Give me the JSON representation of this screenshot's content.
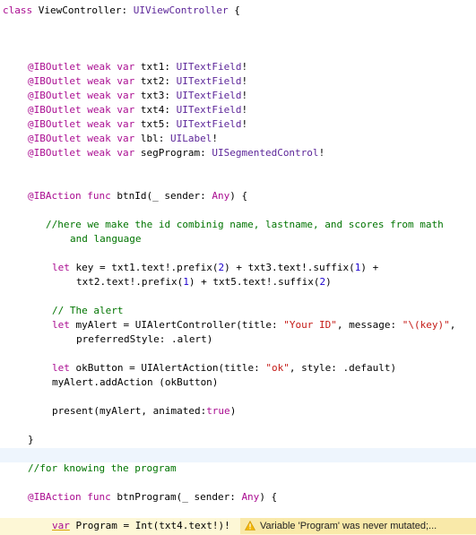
{
  "editor": {
    "lines": [
      {
        "segments": [
          {
            "t": "class ",
            "c": "kw"
          },
          {
            "t": "ViewController",
            "c": "plain"
          },
          {
            "t": ": ",
            "c": "plain"
          },
          {
            "t": "UIViewController",
            "c": "typ"
          },
          {
            "t": " {",
            "c": "plain"
          }
        ]
      },
      {
        "segments": [
          {
            "t": "@IBOutlet ",
            "c": "kw"
          },
          {
            "t": "weak ",
            "c": "kw"
          },
          {
            "t": "var ",
            "c": "kw"
          },
          {
            "t": "txt1: ",
            "c": "plain"
          },
          {
            "t": "UITextField",
            "c": "typ"
          },
          {
            "t": "!",
            "c": "plain"
          }
        ]
      },
      {
        "segments": [
          {
            "t": "@IBOutlet ",
            "c": "kw"
          },
          {
            "t": "weak ",
            "c": "kw"
          },
          {
            "t": "var ",
            "c": "kw"
          },
          {
            "t": "txt2: ",
            "c": "plain"
          },
          {
            "t": "UITextField",
            "c": "typ"
          },
          {
            "t": "!",
            "c": "plain"
          }
        ]
      },
      {
        "segments": [
          {
            "t": "@IBOutlet ",
            "c": "kw"
          },
          {
            "t": "weak ",
            "c": "kw"
          },
          {
            "t": "var ",
            "c": "kw"
          },
          {
            "t": "txt3: ",
            "c": "plain"
          },
          {
            "t": "UITextField",
            "c": "typ"
          },
          {
            "t": "!",
            "c": "plain"
          }
        ]
      },
      {
        "segments": [
          {
            "t": "@IBOutlet ",
            "c": "kw"
          },
          {
            "t": "weak ",
            "c": "kw"
          },
          {
            "t": "var ",
            "c": "kw"
          },
          {
            "t": "txt4: ",
            "c": "plain"
          },
          {
            "t": "UITextField",
            "c": "typ"
          },
          {
            "t": "!",
            "c": "plain"
          }
        ]
      },
      {
        "segments": [
          {
            "t": "@IBOutlet ",
            "c": "kw"
          },
          {
            "t": "weak ",
            "c": "kw"
          },
          {
            "t": "var ",
            "c": "kw"
          },
          {
            "t": "txt5: ",
            "c": "plain"
          },
          {
            "t": "UITextField",
            "c": "typ"
          },
          {
            "t": "!",
            "c": "plain"
          }
        ]
      },
      {
        "segments": [
          {
            "t": "@IBOutlet ",
            "c": "kw"
          },
          {
            "t": "weak ",
            "c": "kw"
          },
          {
            "t": "var ",
            "c": "kw"
          },
          {
            "t": "lbl: ",
            "c": "plain"
          },
          {
            "t": "UILabel",
            "c": "typ"
          },
          {
            "t": "!",
            "c": "plain"
          }
        ]
      },
      {
        "segments": [
          {
            "t": "@IBOutlet ",
            "c": "kw"
          },
          {
            "t": "weak ",
            "c": "kw"
          },
          {
            "t": "var ",
            "c": "kw"
          },
          {
            "t": "segProgram: ",
            "c": "plain"
          },
          {
            "t": "UISegmentedControl",
            "c": "typ"
          },
          {
            "t": "!",
            "c": "plain"
          }
        ]
      },
      {
        "segments": [
          {
            "t": "@IBAction ",
            "c": "kw"
          },
          {
            "t": "func ",
            "c": "kw"
          },
          {
            "t": "btnId(_ sender: ",
            "c": "plain"
          },
          {
            "t": "Any",
            "c": "kw"
          },
          {
            "t": ") {",
            "c": "plain"
          }
        ]
      },
      {
        "segments": [
          {
            "t": "//here we make the id combinig name, lastname, and scores from math",
            "c": "cmt"
          }
        ]
      },
      {
        "segments": [
          {
            "t": "and language",
            "c": "cmt"
          }
        ]
      },
      {
        "segments": [
          {
            "t": "let ",
            "c": "kw"
          },
          {
            "t": "key = txt1.text!.prefix(",
            "c": "plain"
          },
          {
            "t": "2",
            "c": "num"
          },
          {
            "t": ") + txt3.text!.suffix(",
            "c": "plain"
          },
          {
            "t": "1",
            "c": "num"
          },
          {
            "t": ") +",
            "c": "plain"
          }
        ]
      },
      {
        "segments": [
          {
            "t": "txt2.text!.prefix(",
            "c": "plain"
          },
          {
            "t": "1",
            "c": "num"
          },
          {
            "t": ") + txt5.text!.suffix(",
            "c": "plain"
          },
          {
            "t": "2",
            "c": "num"
          },
          {
            "t": ")",
            "c": "plain"
          }
        ]
      },
      {
        "segments": [
          {
            "t": "// The alert",
            "c": "cmt"
          }
        ]
      },
      {
        "segments": [
          {
            "t": "let ",
            "c": "kw"
          },
          {
            "t": "myAlert = UIAlertController(title: ",
            "c": "plain"
          },
          {
            "t": "\"Your ID\"",
            "c": "str"
          },
          {
            "t": ", message: ",
            "c": "plain"
          },
          {
            "t": "\"\\(key)\"",
            "c": "str"
          },
          {
            "t": ",",
            "c": "plain"
          }
        ]
      },
      {
        "segments": [
          {
            "t": "preferredStyle: .alert)",
            "c": "plain"
          }
        ]
      },
      {
        "segments": [
          {
            "t": "let ",
            "c": "kw"
          },
          {
            "t": "okButton = UIAlertAction(title: ",
            "c": "plain"
          },
          {
            "t": "\"ok\"",
            "c": "str"
          },
          {
            "t": ", style: .default)",
            "c": "plain"
          }
        ]
      },
      {
        "segments": [
          {
            "t": "myAlert.addAction (okButton)",
            "c": "plain"
          }
        ]
      },
      {
        "segments": [
          {
            "t": "present(myAlert, animated:",
            "c": "plain"
          },
          {
            "t": "true",
            "c": "kw"
          },
          {
            "t": ")",
            "c": "plain"
          }
        ]
      },
      {
        "segments": [
          {
            "t": "}",
            "c": "plain"
          }
        ]
      },
      {
        "segments": [
          {
            "t": "//for knowing the program",
            "c": "cmt"
          }
        ]
      },
      {
        "segments": [
          {
            "t": "@IBAction ",
            "c": "kw"
          },
          {
            "t": "func ",
            "c": "kw"
          },
          {
            "t": "btnProgram(_ sender: ",
            "c": "plain"
          },
          {
            "t": "Any",
            "c": "kw"
          },
          {
            "t": ") {",
            "c": "plain"
          }
        ]
      },
      {
        "segments": [
          {
            "t": "var",
            "c": "kw"
          },
          {
            "t": " ",
            "c": "plain"
          },
          {
            "t": "Program",
            "c": "plain"
          },
          {
            "t": " = Int(txt4.text!)!",
            "c": "plain"
          }
        ]
      }
    ],
    "warning": {
      "icon": "warning-triangle-icon",
      "text": "Variable 'Program' was never mutated;..."
    },
    "colors": {
      "keyword": "#aa0d91",
      "type": "#5c2699",
      "number": "#1c00cf",
      "string": "#c41a16",
      "comment": "#007400",
      "current_line": "#eef5fd",
      "warning_line": "#fdf7d6",
      "warning_badge": "#f9e9a9"
    }
  }
}
